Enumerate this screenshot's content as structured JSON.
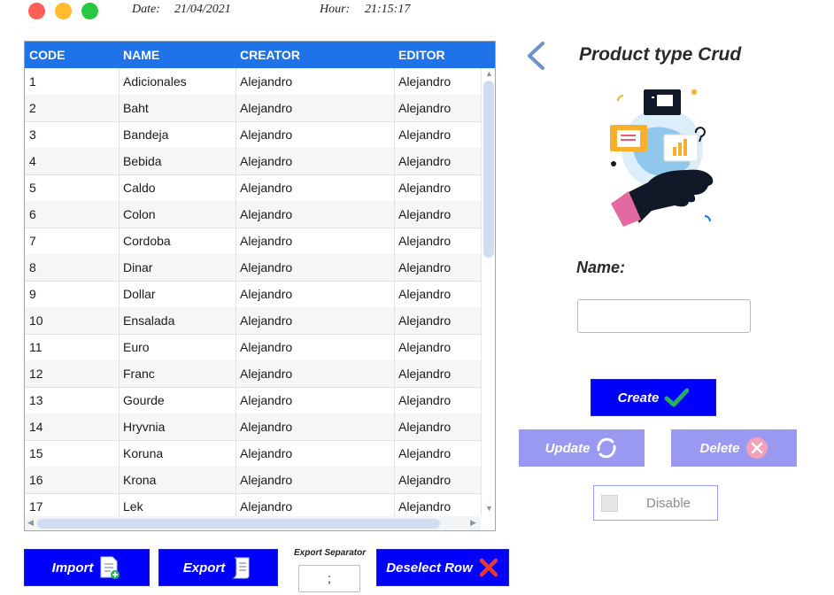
{
  "window_controls": {
    "close_color": "#ff5f57",
    "minimize_color": "#febc2e",
    "maximize_color": "#28c840"
  },
  "header": {
    "date_label": "Date:",
    "date_value": "21/04/2021",
    "hour_label": "Hour:",
    "hour_value": "21:15:17"
  },
  "grid": {
    "columns": [
      "CODE",
      "NAME",
      "CREATOR",
      "EDITOR"
    ],
    "rows": [
      [
        "1",
        "Adicionales",
        "Alejandro",
        "Alejandro"
      ],
      [
        "2",
        "Baht",
        "Alejandro",
        "Alejandro"
      ],
      [
        "3",
        "Bandeja",
        "Alejandro",
        "Alejandro"
      ],
      [
        "4",
        "Bebida",
        "Alejandro",
        "Alejandro"
      ],
      [
        "5",
        "Caldo",
        "Alejandro",
        "Alejandro"
      ],
      [
        "6",
        "Colon",
        "Alejandro",
        "Alejandro"
      ],
      [
        "7",
        "Cordoba",
        "Alejandro",
        "Alejandro"
      ],
      [
        "8",
        "Dinar",
        "Alejandro",
        "Alejandro"
      ],
      [
        "9",
        "Dollar",
        "Alejandro",
        "Alejandro"
      ],
      [
        "10",
        "Ensalada",
        "Alejandro",
        "Alejandro"
      ],
      [
        "11",
        "Euro",
        "Alejandro",
        "Alejandro"
      ],
      [
        "12",
        "Franc",
        "Alejandro",
        "Alejandro"
      ],
      [
        "13",
        "Gourde",
        "Alejandro",
        "Alejandro"
      ],
      [
        "14",
        "Hryvnia",
        "Alejandro",
        "Alejandro"
      ],
      [
        "15",
        "Koruna",
        "Alejandro",
        "Alejandro"
      ],
      [
        "16",
        "Krona",
        "Alejandro",
        "Alejandro"
      ],
      [
        "17",
        "Lek",
        "Alejandro",
        "Alejandro"
      ]
    ],
    "header_color": "#1e73e8"
  },
  "form": {
    "back_icon": "chevron-left-icon",
    "title": "Product type Crud",
    "name_label": "Name:",
    "name_value": "",
    "create_label": "Create",
    "update_label": "Update",
    "delete_label": "Delete",
    "disable_label": "Disable",
    "disable_checked": false
  },
  "bottom": {
    "import_label": "Import",
    "export_label": "Export",
    "export_separator_label": "Export Separator",
    "export_separator_value": ";",
    "deselect_label": "Deselect Row"
  },
  "colors": {
    "primary_button": "#0000ff",
    "disabled_button": "#9999f2",
    "accent_green": "#27ae60",
    "accent_red": "#e53935"
  }
}
